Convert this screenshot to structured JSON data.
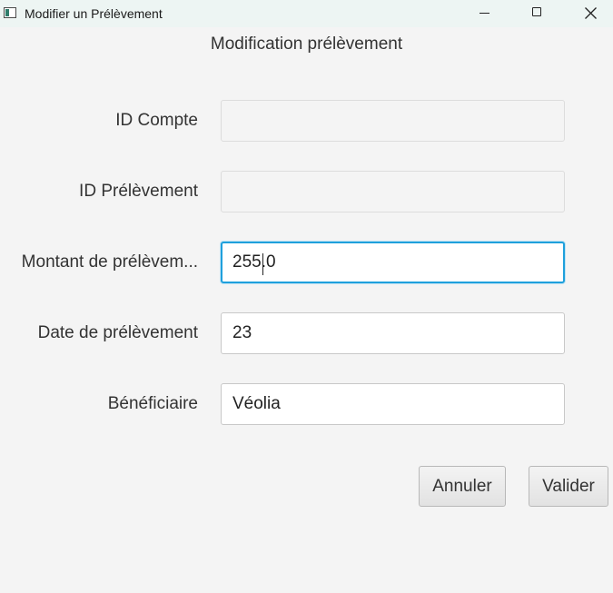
{
  "window": {
    "title": "Modifier un Prélèvement"
  },
  "form": {
    "heading": "Modification prélèvement",
    "fields": [
      {
        "label": "ID Compte",
        "value": "",
        "enabled": false
      },
      {
        "label": "ID Prélèvement",
        "value": "",
        "enabled": false
      },
      {
        "label": "Montant de prélèvem...",
        "value": "255.0",
        "enabled": true,
        "focused": true
      },
      {
        "label": "Date de prélèvement",
        "value": "23",
        "enabled": true
      },
      {
        "label": "Bénéficiaire",
        "value": "Véolia",
        "enabled": true
      }
    ]
  },
  "buttons": {
    "cancel": "Annuler",
    "submit": "Valider"
  },
  "colors": {
    "focus_accent": "#1fa0dc",
    "window_bg": "#f4f4f4",
    "titlebar_bg": "#edf5f3"
  }
}
